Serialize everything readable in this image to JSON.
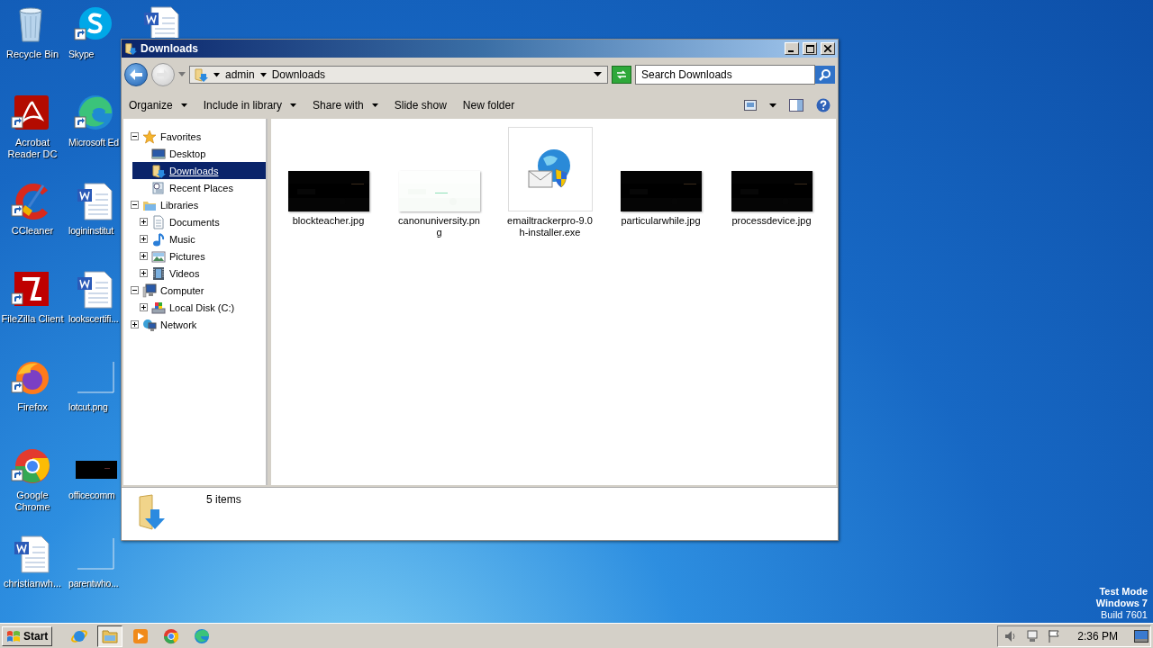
{
  "desktop": {
    "icons": [
      {
        "label": "Recycle Bin",
        "kind": "recycle",
        "shortcut": false
      },
      {
        "label": "Acrobat Reader DC",
        "kind": "acrobat",
        "shortcut": true
      },
      {
        "label": "CCleaner",
        "kind": "ccleaner",
        "shortcut": true
      },
      {
        "label": "FileZilla Client",
        "kind": "filezilla",
        "shortcut": true
      },
      {
        "label": "Firefox",
        "kind": "firefox",
        "shortcut": true
      },
      {
        "label": "Google Chrome",
        "kind": "chrome",
        "shortcut": true
      },
      {
        "label": "christianwh...",
        "kind": "word",
        "shortcut": false
      },
      {
        "label": "Skype",
        "kind": "skype",
        "shortcut": true
      },
      {
        "label": "Microsoft Ed",
        "kind": "edge",
        "shortcut": true
      },
      {
        "label": "logininstitut",
        "kind": "word",
        "shortcut": false
      },
      {
        "label": "lookscertifi...",
        "kind": "word",
        "shortcut": false
      },
      {
        "label": "lotcut.png",
        "kind": "image-light",
        "shortcut": false
      },
      {
        "label": "officecomm",
        "kind": "image-dark",
        "shortcut": false
      },
      {
        "label": "parentwho...",
        "kind": "image-light",
        "shortcut": false
      },
      {
        "kind": "word",
        "shortcut": false
      }
    ],
    "os_notice": [
      "Test Mode",
      "Windows 7",
      "Build 7601"
    ]
  },
  "window": {
    "title": "Downloads",
    "address": {
      "crumbs": [
        "admin",
        "Downloads"
      ]
    },
    "search": {
      "placeholder": "Search Downloads"
    },
    "toolbar": [
      {
        "label": "Organize",
        "dropdown": true
      },
      {
        "label": "Include in library",
        "dropdown": true
      },
      {
        "label": "Share with",
        "dropdown": true
      },
      {
        "label": "Slide show",
        "dropdown": false
      },
      {
        "label": "New folder",
        "dropdown": false
      }
    ],
    "nav": [
      {
        "label": "Favorites",
        "kind": "star",
        "expanded": true,
        "selected": false,
        "children": [
          {
            "label": "Desktop",
            "kind": "desktop",
            "selected": false
          },
          {
            "label": "Downloads",
            "kind": "downloads",
            "selected": true
          },
          {
            "label": "Recent Places",
            "kind": "recent",
            "selected": false
          }
        ]
      },
      {
        "label": "Libraries",
        "kind": "libraries",
        "expanded": true,
        "selected": false,
        "children": [
          {
            "label": "Documents",
            "kind": "documents",
            "expanded": false,
            "selected": false
          },
          {
            "label": "Music",
            "kind": "music",
            "expanded": false,
            "selected": false
          },
          {
            "label": "Pictures",
            "kind": "pictures",
            "expanded": false,
            "selected": false
          },
          {
            "label": "Videos",
            "kind": "videos",
            "expanded": false,
            "selected": false
          }
        ]
      },
      {
        "label": "Computer",
        "kind": "computer",
        "expanded": true,
        "selected": false,
        "children": [
          {
            "label": "Local Disk (C:)",
            "kind": "disk",
            "expanded": false,
            "selected": false
          }
        ]
      },
      {
        "label": "Network",
        "kind": "network",
        "expanded": false,
        "selected": false
      }
    ],
    "files": [
      {
        "name": "blockteacher.jpg",
        "kind": "image-dark"
      },
      {
        "name": "canonuniversity.png",
        "kind": "image-light"
      },
      {
        "name": "emailtrackerpro-9.0h-installer.exe",
        "kind": "installer"
      },
      {
        "name": "particularwhile.jpg",
        "kind": "image-dark"
      },
      {
        "name": "processdevice.jpg",
        "kind": "image-dark"
      }
    ],
    "status": "5 items"
  },
  "taskbar": {
    "start": "Start",
    "apps": [
      {
        "kind": "ie",
        "selected": false
      },
      {
        "kind": "explorer",
        "selected": true
      },
      {
        "kind": "media",
        "selected": false
      },
      {
        "kind": "chrome",
        "selected": false
      },
      {
        "kind": "edge",
        "selected": false
      }
    ],
    "clock": "2:36 PM"
  }
}
